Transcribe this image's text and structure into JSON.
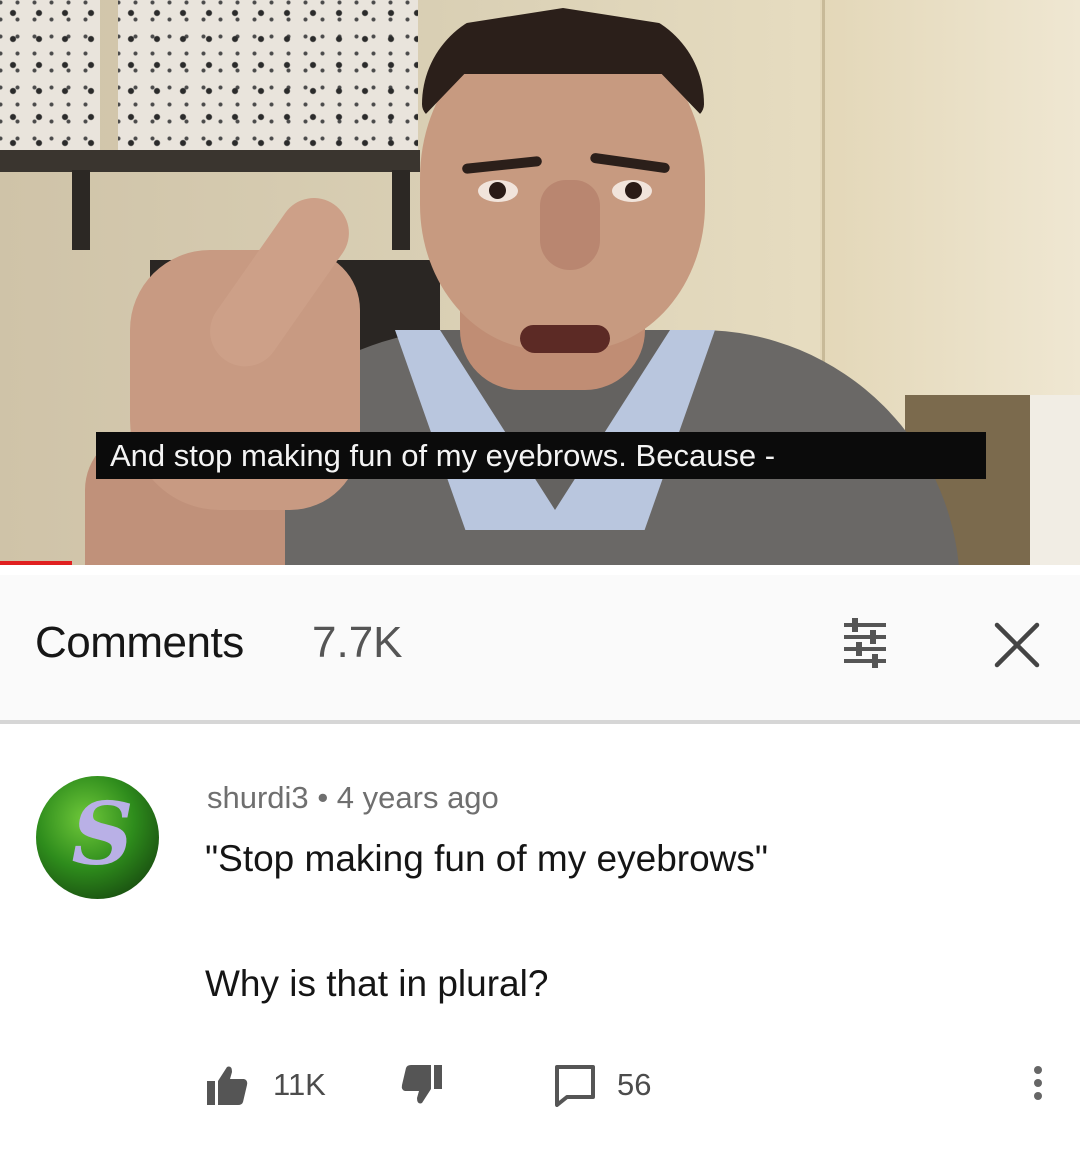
{
  "video": {
    "caption": "And stop making fun of my eyebrows. Because -",
    "progress": 0.067
  },
  "comments_header": {
    "title": "Comments",
    "count": "7.7K",
    "sort_icon": "sort-icon",
    "close_icon": "close-icon"
  },
  "comment": {
    "author": "shurdi3",
    "separator": "•",
    "time": "4 years ago",
    "avatar_letter": "S",
    "lines": [
      "\"Stop making fun of my eyebrows\"",
      "Why is that in plural?"
    ],
    "likes": "11K",
    "replies": "56",
    "like_icon": "thumbs-up-icon",
    "dislike_icon": "thumbs-down-icon",
    "reply_icon": "reply-icon",
    "more_icon": "more-vertical-icon"
  },
  "colors": {
    "progress": "#e02020",
    "caption_bg": "#0b0b0b",
    "avatar": "#2e8c1c"
  }
}
